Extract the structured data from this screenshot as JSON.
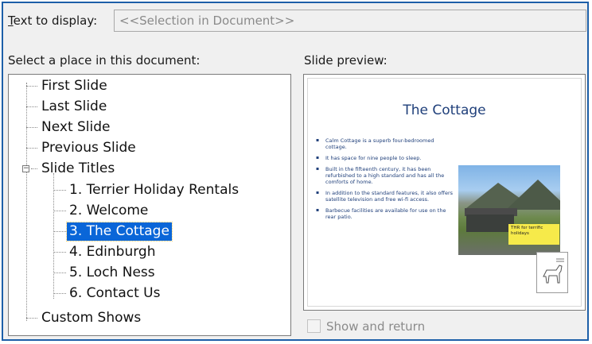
{
  "text_to_display": {
    "label_pre": "",
    "label_accel": "T",
    "label_post": "ext to display:",
    "value": "<<Selection in Document>>"
  },
  "place_label": "Select a place in this document:",
  "preview_label": "Slide preview:",
  "tree": {
    "first_slide": "First Slide",
    "last_slide": "Last Slide",
    "next_slide": "Next Slide",
    "previous_slide": "Previous Slide",
    "slide_titles": "Slide Titles",
    "slides": [
      "1. Terrier Holiday Rentals",
      "2. Welcome",
      "3. The Cottage",
      "4. Edinburgh",
      "5. Loch Ness",
      "6. Contact Us"
    ],
    "custom_shows": "Custom Shows",
    "selected": "3. The Cottage"
  },
  "slide_preview": {
    "title": "The Cottage",
    "bullets": [
      "Calm Cottage is a superb four-bedroomed cottage.",
      "It has space for nine people to sleep.",
      "Built in the fifteenth century, it has been refurbished to a high standard and has all the comforts of home.",
      "In addition to the standard features, it also offers satellite television and free wi-fi access.",
      "Barbecue facilities are available for use on the rear patio."
    ],
    "callout": "THR for terrific holidays"
  },
  "show_and_return": {
    "label": "Show and return",
    "checked": false
  },
  "colors": {
    "selection": "#0a66d8",
    "frame_accent": "#1d5fa8",
    "slide_title": "#1f3f7a"
  }
}
